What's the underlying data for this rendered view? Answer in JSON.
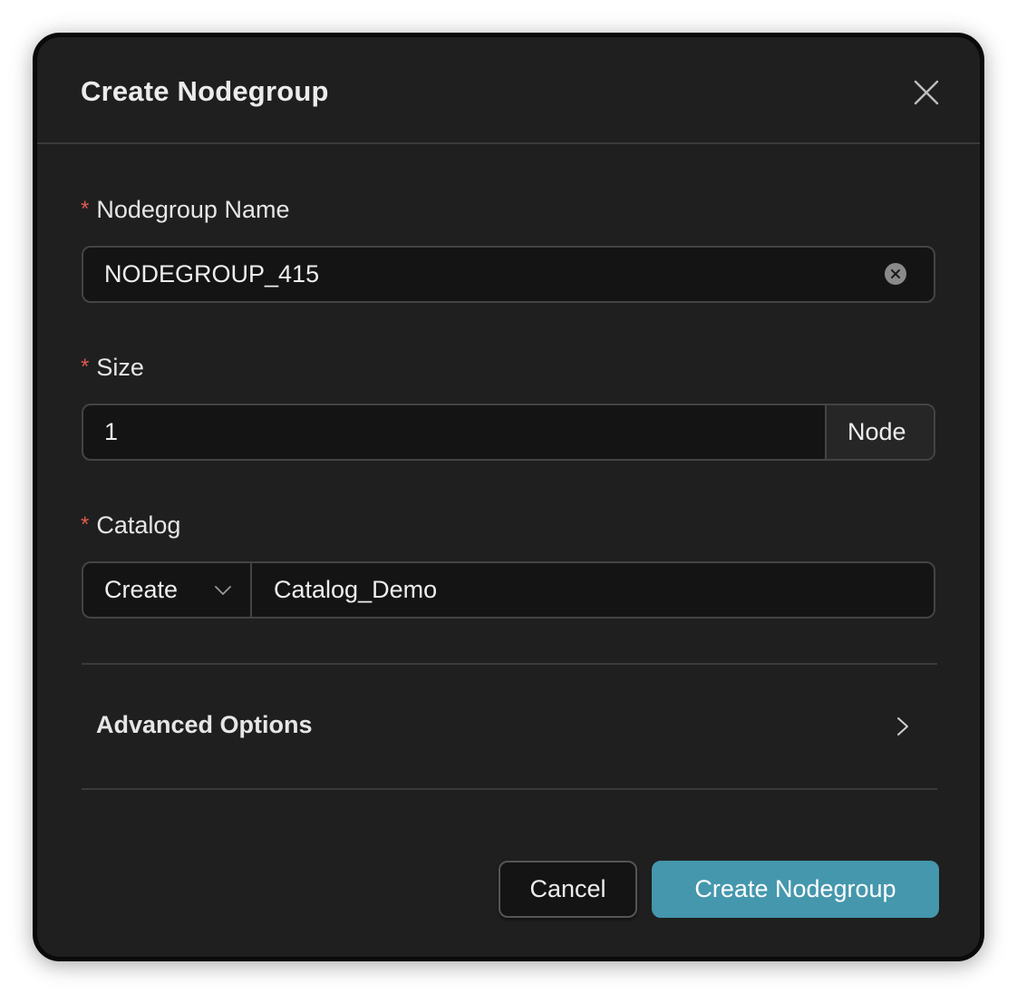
{
  "dialog": {
    "title": "Create Nodegroup"
  },
  "fields": {
    "name": {
      "required_mark": "*",
      "label": "Nodegroup Name",
      "value": "NODEGROUP_415"
    },
    "size": {
      "required_mark": "*",
      "label": "Size",
      "value": "1",
      "unit": "Node"
    },
    "catalog": {
      "required_mark": "*",
      "label": "Catalog",
      "mode": "Create",
      "value": "Catalog_Demo"
    }
  },
  "advanced": {
    "label": "Advanced Options"
  },
  "footer": {
    "cancel_label": "Cancel",
    "submit_label": "Create Nodegroup"
  },
  "colors": {
    "modal_bg": "#1f1f1f",
    "input_bg": "#141414",
    "border": "#444444",
    "required": "#e05a4e",
    "primary": "#4597ad",
    "text": "#eeeeee"
  },
  "icons": {
    "close": "close-icon",
    "clear": "clear-circle-icon",
    "select_caret": "chevron-down-icon",
    "expand": "chevron-right-icon"
  }
}
